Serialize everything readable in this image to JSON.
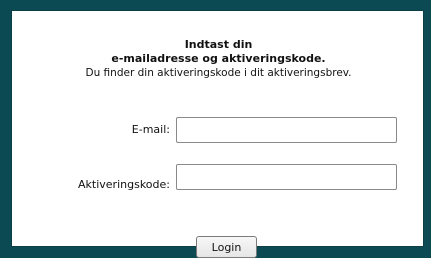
{
  "form": {
    "heading_line1": "Indtast din",
    "heading_line2": "e-mailadresse og aktiveringskode.",
    "hint": "Du finder din aktiveringskode i dit aktiveringsbrev.",
    "email_label": "E-mail:",
    "email_value": "",
    "code_label": "Aktiveringskode:",
    "code_value": "",
    "login_label": "Login"
  },
  "colors": {
    "background": "#0b4a52",
    "panel": "#ffffff"
  }
}
